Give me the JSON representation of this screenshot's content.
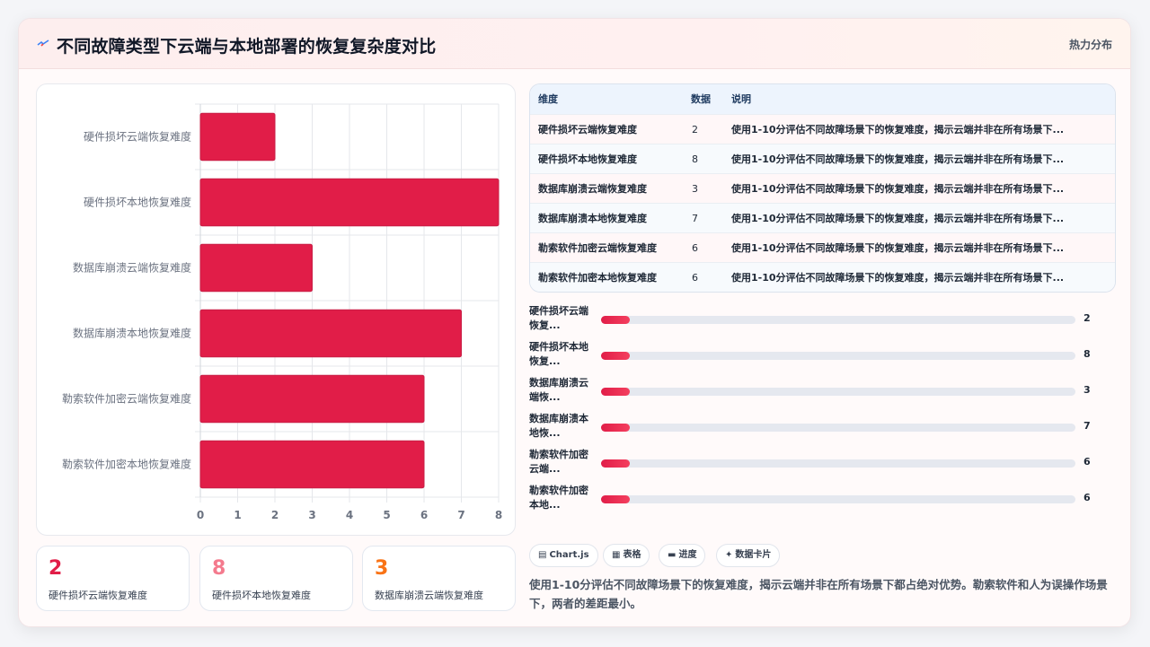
{
  "header": {
    "icon": "lightning-icon",
    "title": "不同故障类型下云端与本地部署的恢复复杂度对比",
    "tag": "热力分布"
  },
  "colors": {
    "bar": "#e11d48",
    "bar_border": "#c81e45",
    "stat_1": "#e11d48",
    "stat_2": "#f47a8d",
    "stat_3": "#f97316"
  },
  "chart_data": {
    "type": "bar",
    "orientation": "horizontal",
    "categories": [
      "硬件损坏云端恢复难度",
      "硬件损坏本地恢复难度",
      "数据库崩溃云端恢复难度",
      "数据库崩溃本地恢复难度",
      "勒索软件加密云端恢复难度",
      "勒索软件加密本地恢复难度"
    ],
    "values": [
      2,
      8,
      3,
      7,
      6,
      6
    ],
    "xlim": [
      0,
      8
    ],
    "xticks": [
      0,
      1,
      2,
      3,
      4,
      5,
      6,
      7,
      8
    ],
    "grid": true,
    "legend": "none"
  },
  "stats": [
    {
      "value": "2",
      "label": "硬件损坏云端恢复难度"
    },
    {
      "value": "8",
      "label": "硬件损坏本地恢复难度"
    },
    {
      "value": "3",
      "label": "数据库崩溃云端恢复难度"
    }
  ],
  "table": {
    "headers": [
      "维度",
      "数据",
      "说明"
    ],
    "rows": [
      {
        "name": "硬件损坏云端恢复难度",
        "value": "2",
        "desc": "使用1-10分评估不同故障场景下的恢复难度，揭示云端并非在所有场景下..."
      },
      {
        "name": "硬件损坏本地恢复难度",
        "value": "8",
        "desc": "使用1-10分评估不同故障场景下的恢复难度，揭示云端并非在所有场景下..."
      },
      {
        "name": "数据库崩溃云端恢复难度",
        "value": "3",
        "desc": "使用1-10分评估不同故障场景下的恢复难度，揭示云端并非在所有场景下..."
      },
      {
        "name": "数据库崩溃本地恢复难度",
        "value": "7",
        "desc": "使用1-10分评估不同故障场景下的恢复难度，揭示云端并非在所有场景下..."
      },
      {
        "name": "勒索软件加密云端恢复难度",
        "value": "6",
        "desc": "使用1-10分评估不同故障场景下的恢复难度，揭示云端并非在所有场景下..."
      },
      {
        "name": "勒索软件加密本地恢复难度",
        "value": "6",
        "desc": "使用1-10分评估不同故障场景下的恢复难度，揭示云端并非在所有场景下..."
      }
    ]
  },
  "progress": [
    {
      "label_line1": "硬件损坏云端",
      "label_line2": "恢复...",
      "value": "2",
      "fill_fraction": 0.06
    },
    {
      "label_line1": "硬件损坏本地",
      "label_line2": "恢复...",
      "value": "8",
      "fill_fraction": 0.06
    },
    {
      "label_line1": "数据库崩溃云",
      "label_line2": "端恢...",
      "value": "3",
      "fill_fraction": 0.06
    },
    {
      "label_line1": "数据库崩溃本",
      "label_line2": "地恢...",
      "value": "7",
      "fill_fraction": 0.06
    },
    {
      "label_line1": "勒索软件加密",
      "label_line2": "云端...",
      "value": "6",
      "fill_fraction": 0.06
    },
    {
      "label_line1": "勒索软件加密",
      "label_line2": "本地...",
      "value": "6",
      "fill_fraction": 0.06
    }
  ],
  "chips": [
    {
      "icon": "bar-chart-icon",
      "label": "Chart.js"
    },
    {
      "icon": "table-icon",
      "label": "表格"
    },
    {
      "icon": "progress-icon",
      "label": "进度"
    },
    {
      "icon": "sparkle-icon",
      "label": "数据卡片"
    }
  ],
  "summary": "使用1-10分评估不同故障场景下的恢复难度，揭示云端并非在所有场景下都占绝对优势。勒索软件和人为误操作场景下，两者的差距最小。"
}
